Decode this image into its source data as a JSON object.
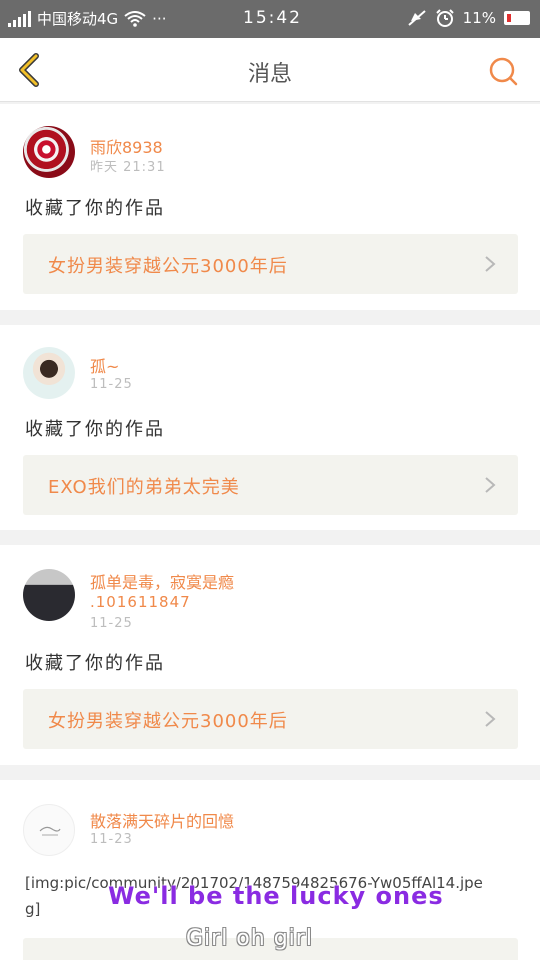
{
  "status_bar": {
    "carrier": "中国移动4G",
    "dots": "···",
    "time": "15:42",
    "battery": "11%"
  },
  "nav": {
    "title": "消息",
    "back_icon": "chevron-left-icon",
    "search_icon": "search-icon"
  },
  "colors": {
    "accent": "#f0894a",
    "back_arrow": "#f2c029",
    "link_bg": "#f3f3ee"
  },
  "messages": [
    {
      "username": "雨欣8938",
      "time": "昨天 21:31",
      "action": "收藏了你的作品",
      "work_title": "女扮男装穿越公元3000年后"
    },
    {
      "username": "孤~",
      "time": "11-25",
      "action": "收藏了你的作品",
      "work_title": "EXO我们的弟弟太完美"
    },
    {
      "username": "孤单是毒，寂寞是瘾",
      "username_line2": ".101611847",
      "time": "11-25",
      "action": "收藏了你的作品",
      "work_title": "女扮男装穿越公元3000年后"
    },
    {
      "username": "散落满天碎片的回憶",
      "time": "11-23",
      "text": "[img:pic/community/201702/1487594825676-Yw05ffAl14.jpeg]"
    }
  ],
  "overlay": {
    "lyric_line1": "We'll be the lucky ones",
    "lyric_line2": "Girl oh girl"
  }
}
